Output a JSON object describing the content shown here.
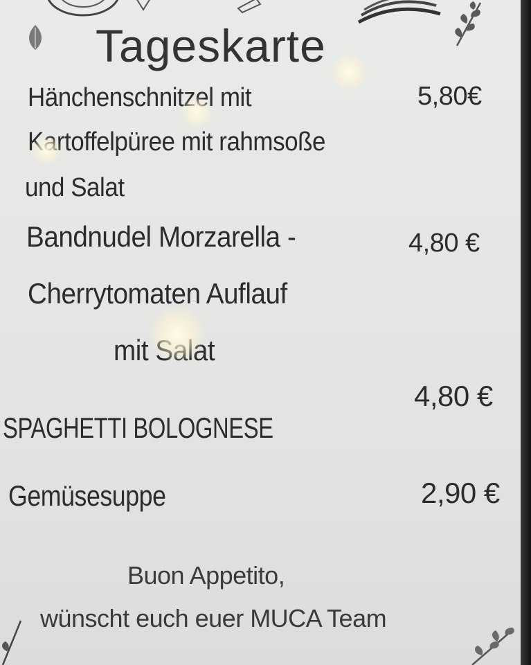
{
  "menu": {
    "title": "Tageskarte",
    "items": [
      {
        "lines": [
          "Hänchenschnitzel mit",
          "Kartoffelpüree mit rahmsoße",
          "und Salat"
        ],
        "price": "5,80€"
      },
      {
        "lines": [
          "Bandnudel Morzarella -",
          "Cherrytomaten Auflauf",
          "mit Salat"
        ],
        "price": "4,80 €"
      },
      {
        "lines": [
          "SPAGHETTI BOLOGNESE"
        ],
        "price": "4,80 €"
      },
      {
        "lines": [
          "Gemüsesuppe"
        ],
        "price": "2,90 €"
      }
    ],
    "footer": {
      "line1": "Buon Appetito,",
      "line2": "wünscht euch euer MUCA Team"
    }
  },
  "decorations": {
    "top_left": "vinyl-record-icon",
    "top_right": "sandwich-icon",
    "leaf": "leaf-icon",
    "branch": "olive-branch-icon"
  }
}
